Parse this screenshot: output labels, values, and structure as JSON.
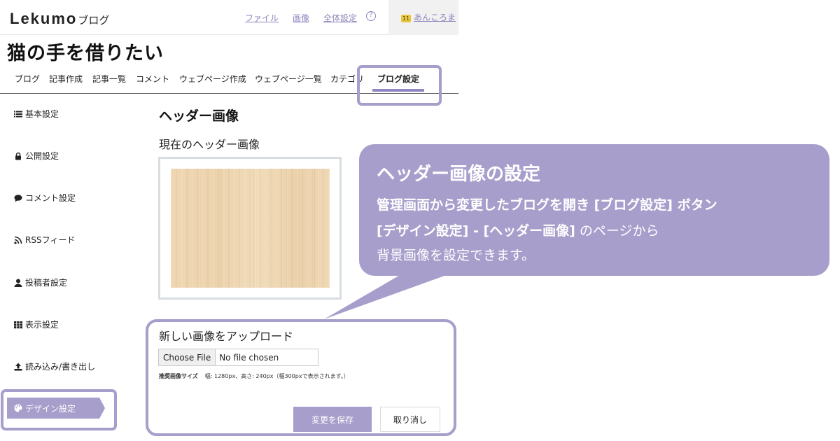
{
  "header": {
    "logo_main": "Lekumo",
    "logo_sub": "ブログ",
    "links": [
      "ファイル",
      "画像",
      "全体設定"
    ],
    "help_symbol": "?",
    "user_name": "あんころま",
    "user_badge": "11"
  },
  "blog_title": "猫の手を借りたい",
  "tabs": [
    "ブログ",
    "記事作成",
    "記事一覧",
    "コメント",
    "ウェブページ作成",
    "ウェブページ一覧",
    "カテゴリ",
    "ブログ設定"
  ],
  "active_tab": "ブログ設定",
  "sidebar": {
    "items": [
      "基本設定",
      "公開設定",
      "コメント設定",
      "RSSフィード",
      "投稿者設定",
      "表示設定",
      "読み込み/書き出し",
      "デザイン設定"
    ],
    "active": "デザイン設定"
  },
  "main": {
    "section_title": "ヘッダー画像",
    "current_label": "現在のヘッダー画像",
    "upload_label": "新しい画像をアップロード",
    "file_button": "Choose File",
    "file_status": "No file chosen",
    "recommend_label": "推奨画像サイズ",
    "recommend_value": "幅: 1280px、高さ: 240px（幅300pxで表示されます。）",
    "save_label": "変更を保存",
    "cancel_label": "取り消し"
  },
  "callout": {
    "title": "ヘッダー画像の設定",
    "line1": "管理画面から変更したブログを開き [ブログ設定] ボタン",
    "line2_bold": "[デザイン設定] - [ヘッダー画像]",
    "line2_rest": " のページから",
    "line3": "背景画像を設定できます。"
  },
  "colors": {
    "accent": "#a79ecb",
    "link": "#8e85bd",
    "wood": "#edd5b0"
  }
}
